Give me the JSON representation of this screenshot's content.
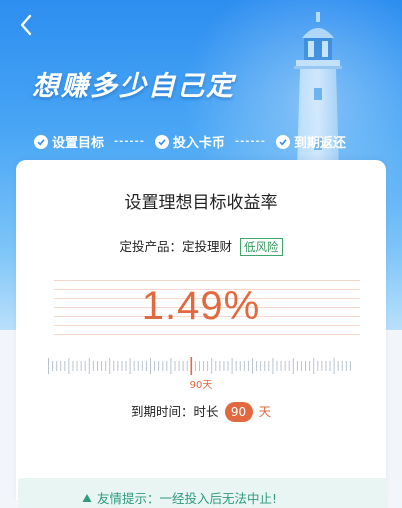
{
  "header": {
    "headline": "想赚多少自己定",
    "steps": [
      {
        "label": "设置目标"
      },
      {
        "label": "投入卡币"
      },
      {
        "label": "到期返还"
      }
    ],
    "step_separator": "------"
  },
  "card": {
    "title": "设置理想目标收益率",
    "product_label": "定投产品：",
    "product_name": "定投理财",
    "risk_badge": "低风险",
    "rate": "1.49%",
    "ruler": {
      "selected_label": "90天",
      "selected_fraction": 0.46
    },
    "due_label": "到期时间：时长",
    "days": "90",
    "days_unit": "天"
  },
  "tip": {
    "text": "友情提示：一经投入后无法中止!"
  },
  "colors": {
    "accent": "#e2683f",
    "header_blue": "#2d8ef0",
    "risk_green": "#2e9a5c",
    "tip_green": "#2f9a7f"
  }
}
